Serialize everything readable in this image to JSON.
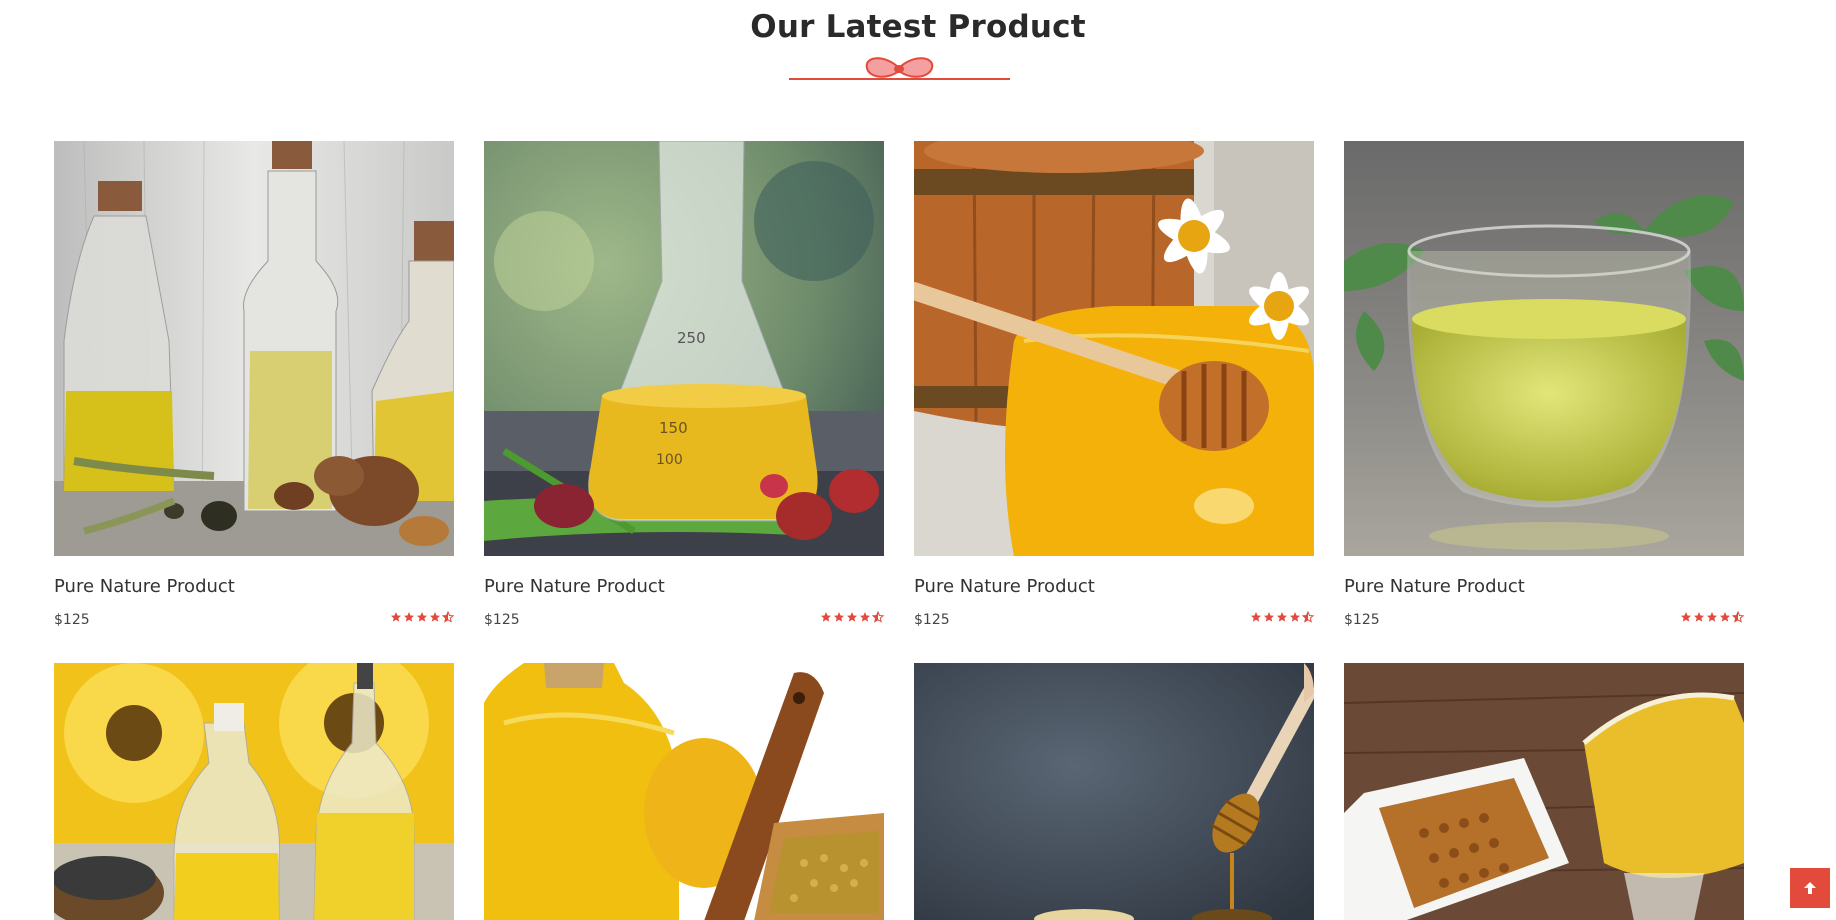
{
  "section": {
    "title": "Our Latest Product"
  },
  "colors": {
    "accent": "#e24a3b",
    "title": "#2a2a2a"
  },
  "products": [
    {
      "name": "Pure Nature Product",
      "price": "$125",
      "rating": 4.5,
      "image": "oil-bottles-walnuts"
    },
    {
      "name": "Pure Nature Product",
      "price": "$125",
      "rating": 4.5,
      "image": "flask-palm-oil"
    },
    {
      "name": "Pure Nature Product",
      "price": "$125",
      "rating": 4.5,
      "image": "honey-jar-dipper"
    },
    {
      "name": "Pure Nature Product",
      "price": "$125",
      "rating": 4.5,
      "image": "glass-cup-oil"
    },
    {
      "name": "",
      "price": "",
      "image": "sunflower-oil-bottles"
    },
    {
      "name": "",
      "price": "",
      "image": "oil-jug-mustard-seeds"
    },
    {
      "name": "",
      "price": "",
      "image": "honey-dipper-dark"
    },
    {
      "name": "",
      "price": "",
      "image": "mustard-seeds-oil-gravy-boat"
    }
  ],
  "scroll_top": {
    "icon": "arrow-up-icon"
  }
}
